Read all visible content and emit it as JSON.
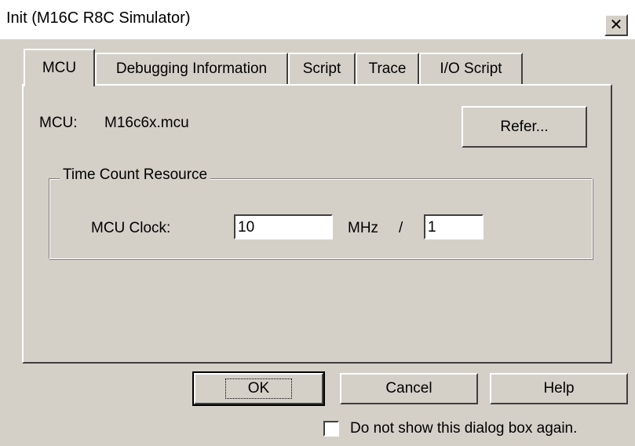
{
  "window": {
    "title": "Init (M16C R8C Simulator)",
    "close_glyph": "✕"
  },
  "tabs": [
    {
      "label": "MCU",
      "active": true
    },
    {
      "label": "Debugging Information",
      "active": false
    },
    {
      "label": "Script",
      "active": false
    },
    {
      "label": "Trace",
      "active": false
    },
    {
      "label": "I/O Script",
      "active": false
    }
  ],
  "mcu": {
    "label": "MCU:",
    "value": "M16c6x.mcu",
    "refer_button": "Refer..."
  },
  "time_count": {
    "group_title": "Time Count Resource",
    "clock_label": "MCU Clock:",
    "clock_value": "10",
    "unit": "MHz",
    "separator": "/",
    "divider_value": "1"
  },
  "buttons": {
    "ok": "OK",
    "cancel": "Cancel",
    "help": "Help"
  },
  "checkbox": {
    "label": "Do not show this dialog box again.",
    "checked": false
  }
}
